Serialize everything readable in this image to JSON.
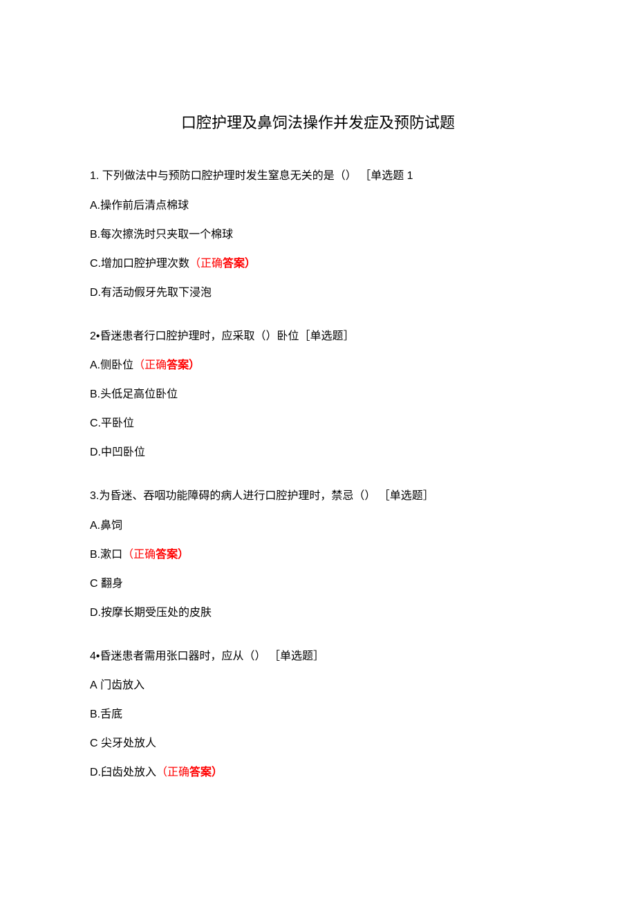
{
  "title": "口腔护理及鼻饲法操作并发症及预防试题",
  "questions": [
    {
      "number": "1.",
      "text": " 下列做法中与预防口腔护理时发生窒息无关的是（） ［单选题 1",
      "options": [
        {
          "letter": "A.",
          "text": "操作前后清点棉球",
          "correct": false
        },
        {
          "letter": "B.",
          "text": "每次擦洗时只夹取一个棉球",
          "correct": false
        },
        {
          "letter": "C.",
          "text": "增加口腔护理次数",
          "correct": true
        },
        {
          "letter": "D.",
          "text": "有活动假牙先取下浸泡",
          "correct": false
        }
      ]
    },
    {
      "number": "2•",
      "text": "昏迷患者行口腔护理时，应采取（）卧位［单选题］",
      "options": [
        {
          "letter": "A.",
          "text": "侧卧位",
          "correct": true
        },
        {
          "letter": "B.",
          "text": "头低足高位卧位",
          "correct": false
        },
        {
          "letter": "C.",
          "text": "平卧位",
          "correct": false
        },
        {
          "letter": "D.",
          "text": "中凹卧位",
          "correct": false
        }
      ]
    },
    {
      "number": "3.",
      "text": "为昏迷、吞咽功能障碍的病人进行口腔护理时，禁忌（） ［单选题］",
      "options": [
        {
          "letter": "A.",
          "text": "鼻饲",
          "correct": false
        },
        {
          "letter": "B.",
          "text": "漱口",
          "correct": true
        },
        {
          "letter": "C",
          "text": " 翻身",
          "correct": false
        },
        {
          "letter": "D.",
          "text": "按摩长期受压处的皮肤",
          "correct": false
        }
      ]
    },
    {
      "number": "4•",
      "text": "昏迷患者需用张口器时，应从（） ［单选题］",
      "options": [
        {
          "letter": "A",
          "text": " 门齿放入",
          "correct": false
        },
        {
          "letter": "B.",
          "text": "舌底",
          "correct": false
        },
        {
          "letter": "C",
          "text": " 尖牙处放人",
          "correct": false
        },
        {
          "letter": "D.",
          "text": "臼齿处放入",
          "correct": true
        }
      ]
    }
  ],
  "correctAnswerLabel": {
    "prefix": "（正确",
    "bold": "答案）"
  }
}
